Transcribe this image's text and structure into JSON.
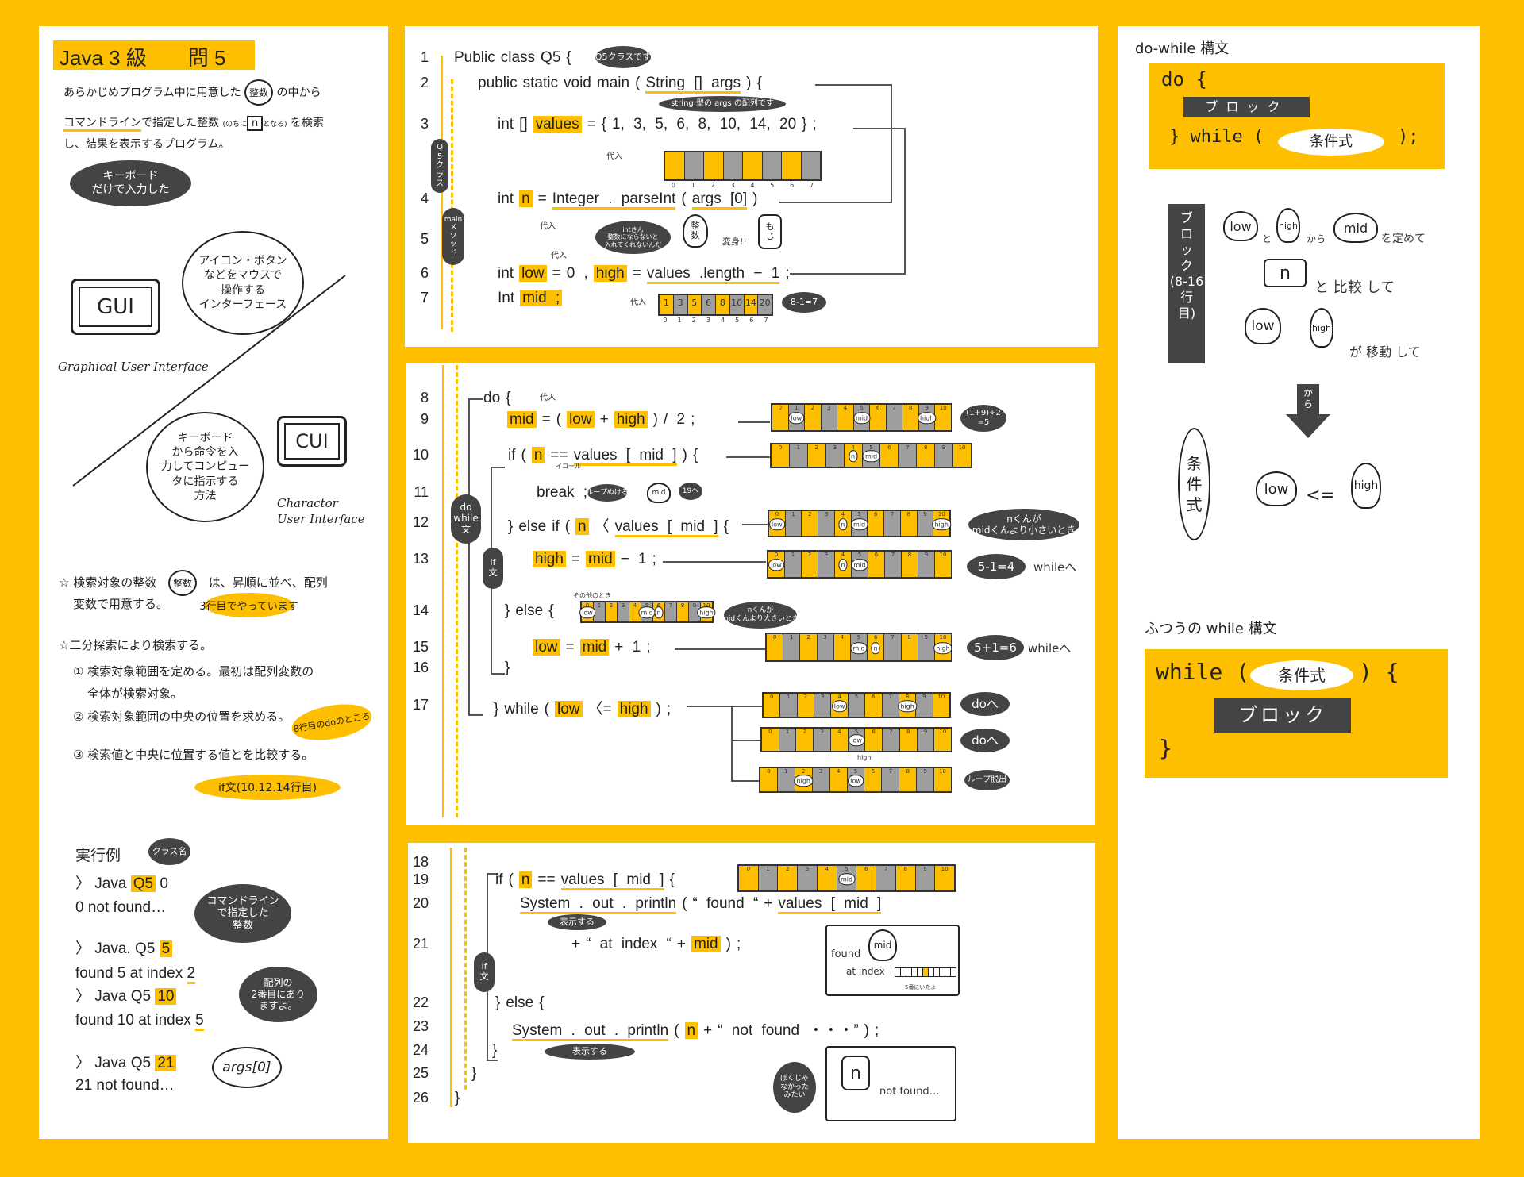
{
  "colors": {
    "background": "#fdbf00",
    "accent": "#fdbf00",
    "dark": "#444444",
    "cell_gray": "#9e9e9e"
  },
  "left": {
    "title": "Java  3 級　　問 5",
    "intro_line1_a": "あらかじめプログラム中に用意した",
    "seisu_icon": "整数",
    "intro_line1_b": "の中から",
    "intro_line2_a": "コマンドライン",
    "intro_line2_b": "で指定した整数",
    "intro_line2_paren": "(のちに",
    "n_icon": "n",
    "intro_line2_paren_b": "となる)",
    "intro_line2_c": "を検索",
    "intro_line3": "し、結果を表示するプログラム。",
    "keyboard_bubble": "キーボード\nだけで入力した",
    "gui_label": "GUI",
    "gui_bubble": "アイコン・ボタン\nなどをマウスで\n操作する\nインターフェース",
    "gui_caption": "Graphical User Interface",
    "cui_label": "CUI",
    "cui_bubble": "キーボード\nから命令を入\n力してコンピュー\nタに指示する\n方法",
    "cui_caption": "Charactor\nUser Interface",
    "star1_a": "☆ 検索対象の整数",
    "star1_icon": "整数",
    "star1_b": "は、昇順に並べ、配列",
    "star1_c": "変数で用意する。",
    "note_line3": "3行目でやっています",
    "star2": "☆二分探索により検索する。",
    "step1_a": "① 検索対象範囲を定める。最初は配列変数の",
    "step1_b": "全体が検索対象。",
    "step2": "② 検索対象範囲の中央の位置を求める。",
    "note_line8": "8行目のdoのところ",
    "step3": "③ 検索値と中央に位置する値とを比較する。",
    "note_if": "if文(10.12.14行目)",
    "example_title": "実行例",
    "classname_bubble": "クラス名",
    "cmdline_bubble": "コマンドライン\nで指定した\n整数",
    "index_bubble": "配列の\n2番目にあり\nますよ。",
    "args_bubble": "args[0]",
    "examples": [
      {
        "prompt": "〉 Java ",
        "cls": "Q5",
        "arg": "0",
        "arg_hl": false,
        "out": "0  not  found…"
      },
      {
        "prompt": "〉 Java. Q5 ",
        "cls": "",
        "arg": "5",
        "arg_hl": true,
        "out_a": "found  5  at  index ",
        "out_idx": "2"
      },
      {
        "prompt": "〉 Java  Q5 ",
        "cls": "",
        "arg": "10",
        "arg_hl": true,
        "out_a": "found  10  at  index ",
        "out_idx": "5"
      },
      {
        "prompt": "〉 Java  Q5 ",
        "cls": "",
        "arg": "21",
        "arg_hl": true,
        "out": "21  not  found…"
      }
    ]
  },
  "code": {
    "lines": [
      {
        "n": "1",
        "t": [
          [
            "Public",
            ""
          ],
          [
            "class",
            ""
          ],
          [
            "Q5",
            ""
          ],
          [
            "{",
            ""
          ]
        ]
      },
      {
        "n": "2",
        "t": [
          [
            "public",
            ""
          ],
          [
            "static",
            ""
          ],
          [
            "void",
            ""
          ],
          [
            "main",
            ""
          ],
          [
            "(",
            ""
          ],
          [
            "String  []  args",
            "ul"
          ],
          [
            ")",
            ""
          ],
          [
            "{",
            ""
          ]
        ]
      },
      {
        "n": "3",
        "t": [
          [
            "int",
            ""
          ],
          [
            "[]",
            ""
          ],
          [
            "values",
            "box"
          ],
          [
            "=",
            ""
          ],
          [
            "{",
            ""
          ],
          [
            "1, 3, 5, 6, 8, 10, 14, 20",
            ""
          ],
          [
            "}",
            ""
          ],
          [
            ";",
            ""
          ]
        ]
      },
      {
        "n": "4",
        "t": [
          [
            "int",
            ""
          ],
          [
            "n",
            "box"
          ],
          [
            "=",
            ""
          ],
          [
            "Integer . parseInt",
            "ul"
          ],
          [
            "(",
            ""
          ],
          [
            "args  [0]",
            "ul"
          ],
          [
            ")",
            ""
          ]
        ]
      },
      {
        "n": "5",
        "t": []
      },
      {
        "n": "6",
        "t": [
          [
            "int",
            ""
          ],
          [
            "low",
            "box"
          ],
          [
            "=",
            ""
          ],
          [
            "0 ,",
            ""
          ],
          [
            "high",
            "box"
          ],
          [
            "=",
            ""
          ],
          [
            "values .length − 1",
            "ul"
          ],
          [
            ";",
            ""
          ]
        ]
      },
      {
        "n": "7",
        "t": [
          [
            "Int",
            ""
          ],
          [
            "mid ;",
            "box"
          ]
        ]
      },
      {
        "n": "8",
        "t": [
          [
            "do",
            ""
          ],
          [
            "{",
            ""
          ]
        ]
      },
      {
        "n": "9",
        "t": [
          [
            "mid",
            "box"
          ],
          [
            "=",
            ""
          ],
          [
            "(",
            ""
          ],
          [
            "low",
            "box"
          ],
          [
            "+",
            ""
          ],
          [
            "high",
            "box"
          ],
          [
            ")",
            ""
          ],
          [
            "/ 2",
            ""
          ],
          [
            ";",
            ""
          ]
        ]
      },
      {
        "n": "10",
        "t": [
          [
            "if",
            ""
          ],
          [
            "(",
            ""
          ],
          [
            "n",
            "box"
          ],
          [
            "==",
            ""
          ],
          [
            "values  [ mid ]",
            "ul"
          ],
          [
            ")",
            ""
          ],
          [
            "{",
            ""
          ]
        ]
      },
      {
        "n": "11",
        "t": [
          [
            "break ;",
            ""
          ]
        ]
      },
      {
        "n": "12",
        "t": [
          [
            "}",
            ""
          ],
          [
            "else",
            ""
          ],
          [
            "if",
            ""
          ],
          [
            "(",
            ""
          ],
          [
            "n",
            "box"
          ],
          [
            "〈",
            ""
          ],
          [
            "values  [ mid ]",
            "ul"
          ],
          [
            "{",
            ""
          ]
        ]
      },
      {
        "n": "13",
        "t": [
          [
            "high",
            "box"
          ],
          [
            "=",
            ""
          ],
          [
            "mid",
            "box"
          ],
          [
            "− 1",
            ""
          ],
          [
            ";",
            ""
          ]
        ]
      },
      {
        "n": "14",
        "t": [
          [
            "}",
            ""
          ],
          [
            "else",
            ""
          ],
          [
            "{",
            ""
          ]
        ]
      },
      {
        "n": "15",
        "t": [
          [
            "low",
            "box"
          ],
          [
            "=",
            ""
          ],
          [
            "mid",
            "box"
          ],
          [
            "+ 1",
            ""
          ],
          [
            ";",
            ""
          ]
        ]
      },
      {
        "n": "16",
        "t": [
          [
            "}",
            ""
          ]
        ]
      },
      {
        "n": "17",
        "t": [
          [
            "}",
            ""
          ],
          [
            "while",
            ""
          ],
          [
            "(",
            ""
          ],
          [
            "low",
            "box"
          ],
          [
            "〈=",
            ""
          ],
          [
            "high",
            "box"
          ],
          [
            ")",
            ""
          ],
          [
            ";",
            ""
          ]
        ]
      },
      {
        "n": "18",
        "t": []
      },
      {
        "n": "19",
        "t": [
          [
            "if",
            ""
          ],
          [
            "(",
            ""
          ],
          [
            "n",
            "box"
          ],
          [
            "==",
            ""
          ],
          [
            "values  [ mid ]",
            "ul"
          ],
          [
            "{",
            ""
          ]
        ]
      },
      {
        "n": "20",
        "t": [
          [
            "System . out . println",
            "ul"
          ],
          [
            "(",
            ""
          ],
          [
            "“ found “",
            ""
          ],
          [
            "+",
            ""
          ],
          [
            "values  [ mid ]",
            "ul"
          ]
        ]
      },
      {
        "n": "21",
        "t": [
          [
            "+",
            ""
          ],
          [
            "“ at index “",
            ""
          ],
          [
            "+",
            ""
          ],
          [
            "mid",
            "box"
          ],
          [
            ")",
            ""
          ],
          [
            ";",
            ""
          ]
        ]
      },
      {
        "n": "22",
        "t": [
          [
            "}",
            ""
          ],
          [
            "else",
            ""
          ],
          [
            "{",
            ""
          ]
        ]
      },
      {
        "n": "23",
        "t": [
          [
            "System . out . println",
            "ul"
          ],
          [
            "(",
            ""
          ],
          [
            "n",
            "box"
          ],
          [
            "+",
            ""
          ],
          [
            "“ not found ・・・”",
            ""
          ],
          [
            ")",
            ""
          ],
          [
            ";",
            ""
          ]
        ]
      },
      {
        "n": "24",
        "t": [
          [
            "}",
            ""
          ]
        ]
      },
      {
        "n": "25",
        "t": [
          [
            "}",
            ""
          ]
        ]
      },
      {
        "n": "26",
        "t": [
          [
            "}",
            ""
          ]
        ]
      }
    ]
  },
  "annotations": {
    "q5_class_bubble": "Q5クラスです",
    "args_bubble": "string 型の args の配列です",
    "q5_pill": "Q\n5\nク\nラ\nス",
    "main_pill": "main\nメ\nソ\nッ\nド",
    "assign": "代入",
    "int_bubble": "intさん\n整数にならないと\n入れてくれないんだ",
    "seisu": "整\n数",
    "moji": "も\nじ",
    "henshin": "変身!!",
    "calc_7": "8-1=7",
    "calc_mid": "(1+9)÷2\n=5",
    "equal": "イコール",
    "loop_exit": "ループぬける",
    "goto19": "19へ",
    "dowhile_pill": "do\nwhile\n文",
    "if_pill": "if\n文",
    "n_smaller": "nくんが\nmidくんより小さいとき",
    "calc_high": "5-1=4",
    "to_while": "whileへ",
    "other": "その他のとき",
    "n_bigger": "nくんが\nmidくんより大きいとき",
    "calc_low": "5+1=6",
    "to_do": "doへ",
    "loop_out": "ループ脱出",
    "display": "表示する",
    "not_me": "ぼくじゃ\nなかった\nみたい",
    "found_label": "found",
    "at_index": "at index",
    "at5": "5番にいたよ",
    "not_found": "not found…"
  },
  "strips": {
    "s3": {
      "values": [
        "",
        "",
        "",
        "",
        "",
        "",
        "",
        ""
      ],
      "index": [
        "0",
        "1",
        "2",
        "3",
        "4",
        "5",
        "6",
        "7"
      ],
      "markers": []
    },
    "s7": {
      "values": [
        "1",
        "3",
        "5",
        "6",
        "8",
        "10",
        "14",
        "20"
      ],
      "index": [
        "0",
        "1",
        "2",
        "3",
        "4",
        "5",
        "6",
        "7"
      ],
      "markers": []
    },
    "s9": {
      "cells": 11,
      "markers": [
        {
          "label": "low",
          "i": 1
        },
        {
          "label": "mid",
          "i": 5
        },
        {
          "label": "high",
          "i": 9
        }
      ]
    },
    "s10": {
      "cells": 11,
      "markers": [
        {
          "label": "n",
          "i": 4
        },
        {
          "label": "mid",
          "i": 5
        }
      ]
    },
    "s12": {
      "cells": 11,
      "markers": [
        {
          "label": "low",
          "i": 0
        },
        {
          "label": "n",
          "i": 4
        },
        {
          "label": "mid",
          "i": 5
        },
        {
          "label": "high",
          "i": 10
        }
      ]
    },
    "s13": {
      "cells": 11,
      "markers": [
        {
          "label": "low",
          "i": 0
        },
        {
          "label": "n",
          "i": 4
        },
        {
          "label": "mid",
          "i": 5
        }
      ]
    },
    "s14": {
      "cells": 11,
      "markers": [
        {
          "label": "low",
          "i": 0
        },
        {
          "label": "mid",
          "i": 5
        },
        {
          "label": "n",
          "i": 6
        },
        {
          "label": "high",
          "i": 10
        }
      ]
    },
    "s15": {
      "cells": 11,
      "markers": [
        {
          "label": "mid",
          "i": 5
        },
        {
          "label": "n",
          "i": 6
        },
        {
          "label": "high",
          "i": 10
        }
      ]
    },
    "s17a": {
      "cells": 11,
      "markers": [
        {
          "label": "low",
          "i": 4
        },
        {
          "label": "high",
          "i": 8
        }
      ]
    },
    "s17b": {
      "cells": 11,
      "markers": [
        {
          "label": "low",
          "i": 5
        }
      ],
      "below": "high"
    },
    "s17c": {
      "cells": 11,
      "markers": [
        {
          "label": "high",
          "i": 2
        },
        {
          "label": "low",
          "i": 5
        }
      ]
    },
    "s19": {
      "cells": 11,
      "markers": [
        {
          "label": "n",
          "i": 5
        },
        {
          "label": "mid",
          "i": 5
        }
      ]
    }
  },
  "right": {
    "dowhile_title": "do-while 構文",
    "do_open": "do {",
    "block": "ブロック",
    "do_close": "}  while  (",
    "cond": "条件式",
    "do_end": ");",
    "block_vertical": "ブ\nロ\nッ\nク\n(8-16\n行\n目)",
    "low": "low",
    "high": "high",
    "mid": "mid",
    "n": "n",
    "to": "と",
    "kara": "から",
    "sadamete": "を定めて",
    "hikaku": "と 比較 して",
    "idou": "が 移動 して",
    "arrow_kara": "か\nら",
    "cond_vertical": "条\n件\n式",
    "le": "<=",
    "while_title": "ふつうの while 構文",
    "while_open": "while (",
    "while_brace": ") {",
    "while_close": "}"
  }
}
